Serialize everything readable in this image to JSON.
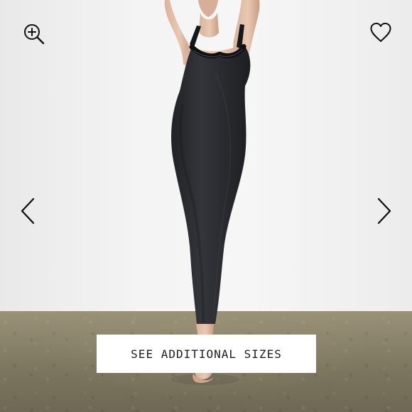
{
  "viewer": {
    "cta_label": "SEE ADDITIONAL SIZES"
  },
  "icons": {
    "zoom": "zoom-in-icon",
    "favorite": "heart-icon",
    "previous": "chevron-left-icon",
    "next": "chevron-right-icon"
  },
  "colors": {
    "dress": "#2f3034",
    "lace": "#17181b",
    "button_bg": "#ffffff",
    "button_text": "#1d1d1d",
    "wall": "#f3f3f3",
    "floor": "#8b856d"
  }
}
